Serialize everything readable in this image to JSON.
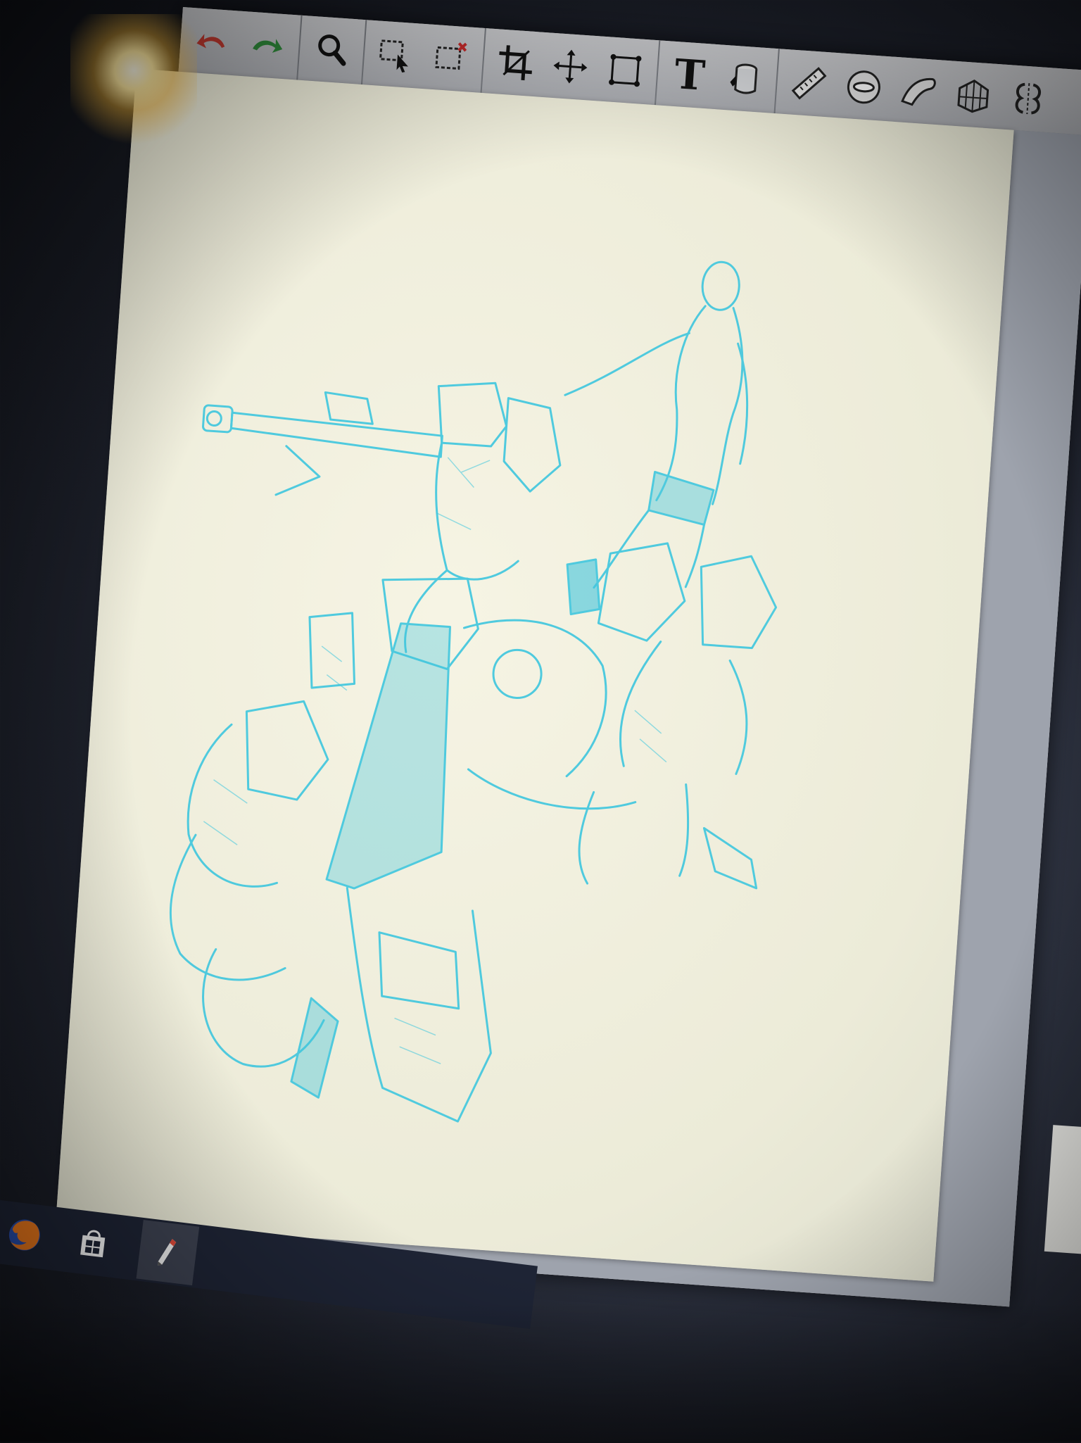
{
  "toolbar": {
    "tools": [
      {
        "name": "undo",
        "icon": "undo-arrow-icon"
      },
      {
        "name": "redo",
        "icon": "redo-arrow-icon"
      },
      {
        "name": "zoom",
        "icon": "magnifier-icon"
      },
      {
        "name": "select",
        "icon": "selection-arrow-icon"
      },
      {
        "name": "deselect",
        "icon": "deselect-icon"
      },
      {
        "name": "crop",
        "icon": "crop-icon"
      },
      {
        "name": "move",
        "icon": "move-arrows-icon"
      },
      {
        "name": "transform",
        "icon": "transform-box-icon"
      },
      {
        "name": "text",
        "icon": "text-tool-icon"
      },
      {
        "name": "fill",
        "icon": "paint-bucket-icon"
      },
      {
        "name": "ruler",
        "icon": "ruler-icon"
      },
      {
        "name": "ellipse-guide",
        "icon": "ellipse-guide-icon"
      },
      {
        "name": "french-curve",
        "icon": "french-curve-icon"
      },
      {
        "name": "perspective",
        "icon": "perspective-grid-icon"
      },
      {
        "name": "symmetry",
        "icon": "symmetry-icon"
      }
    ],
    "text_tool_label": "T"
  },
  "taskbar": {
    "apps": [
      {
        "name": "firefox",
        "icon": "firefox-icon"
      },
      {
        "name": "store",
        "icon": "store-icon"
      },
      {
        "name": "sketchbook",
        "icon": "sketch-app-icon",
        "active": true
      }
    ]
  },
  "canvas": {
    "description_hidden": true,
    "stroke_color": "#3ec6de",
    "paper_color": "#f3f1df"
  },
  "colors": {
    "toolbar_bg": "#bfc1c5",
    "sketch_cyan": "#2fc0dc",
    "redo_green": "#2e8a3a",
    "taskbar": "#1e2435"
  }
}
